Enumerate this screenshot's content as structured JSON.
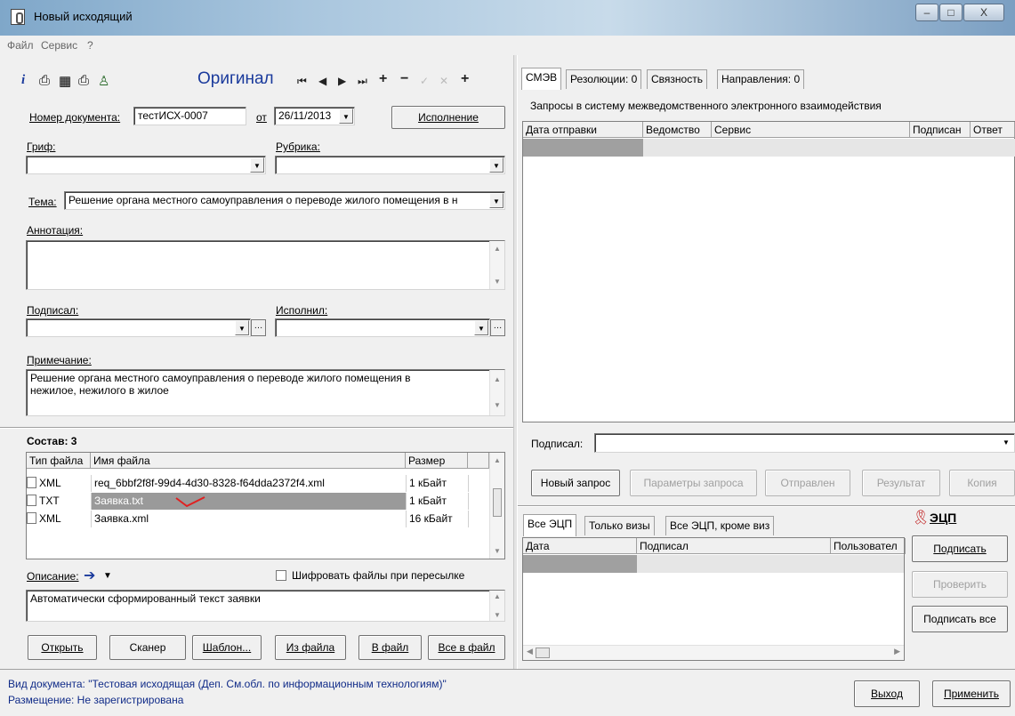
{
  "window": {
    "title": "Новый исходящий",
    "minimize": "–",
    "maximize": "□",
    "close": "X"
  },
  "menu": [
    "Файл",
    "Сервис",
    "?"
  ],
  "toolbar": {
    "heading": "Оригинал"
  },
  "doc": {
    "number_label": "Номер документа:",
    "number_value": "тестИСХ-0007",
    "date_label": "от",
    "date_value": "26/11/2013",
    "execution_button": "Исполнение",
    "grif_label": "Гриф:",
    "rubric_label": "Рубрика:",
    "theme_label": "Тема:",
    "theme_value": "Решение органа местного самоуправления о переводе жилого помещения в н",
    "annotation_label": "Аннотация:",
    "signed_label": "Подписал:",
    "executed_label": "Исполнил:",
    "note_label": "Примечание:",
    "note_value_1": "Решение органа местного самоуправления о переводе жилого помещения в",
    "note_value_2": "нежилое, нежилого в жилое"
  },
  "composition": {
    "title": "Состав: 3",
    "columns": [
      "Тип файла",
      "Имя файла",
      "Размер"
    ],
    "rows": [
      {
        "type": "XML",
        "name": "req_6bbf2f8f-99d4-4d30-8328-f64dda2372f4.xml",
        "size": "1 кБайт"
      },
      {
        "type": "TXT",
        "name": "Заявка.txt",
        "size": "1 кБайт"
      },
      {
        "type": "XML",
        "name": "Заявка.xml",
        "size": "16 кБайт"
      }
    ],
    "description_label": "Описание:",
    "encrypt_label": "Шифровать файлы при пересылке",
    "description_value": "Автоматически сформированный текст заявки",
    "buttons": [
      "Открыть",
      "Сканер",
      "Шаблон...",
      "Из файла",
      "В файл",
      "Все в файл"
    ]
  },
  "right_tabs": [
    "СМЭВ",
    "Резолюции: 0",
    "Связность",
    "Направления: 0"
  ],
  "smev": {
    "caption": "Запросы в систему межведомственного электронного взаимодействия",
    "columns": [
      "Дата отправки",
      "Ведомство",
      "Сервис",
      "Подписан",
      "Ответ"
    ],
    "signed_label": "Подписал:",
    "buttons": [
      "Новый запрос",
      "Параметры запроса",
      "Отправлен",
      "Результат",
      "Копия"
    ]
  },
  "ecp": {
    "tabs": [
      "Все ЭЦП",
      "Только визы",
      "Все ЭЦП, кроме виз"
    ],
    "logo": "ЭЦП",
    "columns": [
      "Дата",
      "Подписал",
      "Пользовател"
    ],
    "buttons": [
      "Подписать",
      "Проверить",
      "Подписать все"
    ]
  },
  "status": {
    "line1": "Вид документа: \"Тестовая исходящая (Деп. См.обл. по информационным технологиям)\"",
    "line2": "Размещение: Не зарегистрирована"
  },
  "footer_buttons": [
    "Выход",
    "Применить"
  ],
  "colors": {
    "accent_blue": "#1a3a9c",
    "status_blue": "#102b88",
    "annotation_red": "#e02020"
  }
}
